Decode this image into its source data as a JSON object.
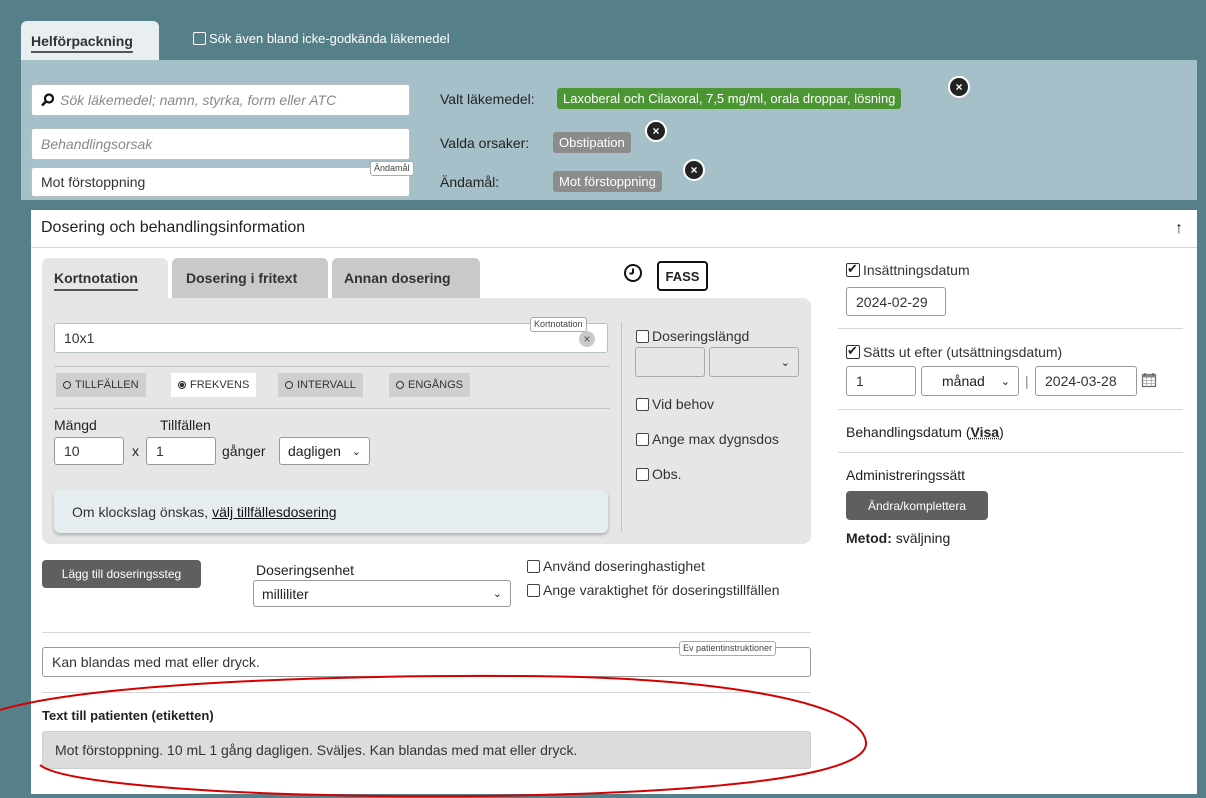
{
  "tabs_top": {
    "active": "Helförpackning",
    "checkbox_label": "Sök även bland icke-godkända läkemedel"
  },
  "search": {
    "placeholder": "Sök läkemedel; namn, styrka, form eller ATC",
    "behandlingsorsak_placeholder": "Behandlingsorsak",
    "andamal_value": "Mot förstoppning",
    "andamal_tag": "Ändamål"
  },
  "selected": {
    "lakemedel_label": "Valt läkemedel:",
    "lakemedel_name": "Laxoberal och Cilaxoral",
    "lakemedel_detail": ", 7,5 mg/ml, orala droppar, lösning",
    "orsaker_label": "Valda orsaker:",
    "orsak_value": "Obstipation",
    "andamal_label": "Ändamål:",
    "andamal_value": "Mot förstoppning",
    "remove_glyph": "×"
  },
  "panel": {
    "title": "Dosering och behandlingsinformation",
    "collapse_glyph": "↑"
  },
  "dose_tabs": [
    "Kortnotation",
    "Dosering i fritext",
    "Annan dosering"
  ],
  "fass_label": "FASS",
  "kortnotation": {
    "value": "10x1",
    "tag": "Kortnotation",
    "clear_glyph": "×"
  },
  "frequency_options": [
    {
      "label": "TILLFÄLLEN",
      "selected": false
    },
    {
      "label": "FREKVENS",
      "selected": true
    },
    {
      "label": "INTERVALL",
      "selected": false
    },
    {
      "label": "ENGÅNGS",
      "selected": false
    }
  ],
  "quantity": {
    "mangd_label": "Mängd",
    "mangd_value": "10",
    "times_symbol": "x",
    "tillfallen_label": "Tillfällen",
    "tillfallen_value": "1",
    "ganger_label": "gånger",
    "period_value": "dagligen"
  },
  "info_box": {
    "text": "Om klockslag önskas, ",
    "link": "välj tillfällesdosering"
  },
  "side_options": {
    "doseringslangd": "Doseringslängd",
    "vid_behov": "Vid behov",
    "max_dygnsdos": "Ange max dygnsdos",
    "obs": "Obs."
  },
  "lagg_till": "Lägg till doseringssteg",
  "doseringsenhet": {
    "label": "Doseringsenhet",
    "value": "milliliter"
  },
  "extra_checks": {
    "hastighet": "Använd doseringhastighet",
    "varaktighet": "Ange varaktighet för doseringstillfällen"
  },
  "patient_instr": {
    "value": "Kan blandas med mat eller dryck.",
    "tag": "Ev patientinstruktioner"
  },
  "etikett": {
    "label": "Text till patienten (etiketten)",
    "text": "Mot förstoppning. 10 mL 1 gång dagligen. Sväljes. Kan blandas med mat eller dryck."
  },
  "right": {
    "insattning_label": "Insättningsdatum",
    "insattning_value": "2024-02-29",
    "satts_ut_label": "Sätts ut efter (utsättningsdatum)",
    "satts_ut_num": "1",
    "satts_ut_unit": "månad",
    "satts_ut_separator": "|",
    "satts_ut_date": "2024-03-28",
    "behandlingsdatum": "Behandlingsdatum (",
    "visa": "Visa",
    "behandlingsdatum_close": ")",
    "administrering_label": "Administreringssätt",
    "andra_button": "Ändra/komplettera",
    "metod_label": "Metod:",
    "metod_value": " sväljning"
  },
  "colors": {
    "teal": "#558089",
    "upper_panel": "#a6c0c9",
    "green_pill": "#4b9633",
    "annotation_red": "#d40000"
  }
}
